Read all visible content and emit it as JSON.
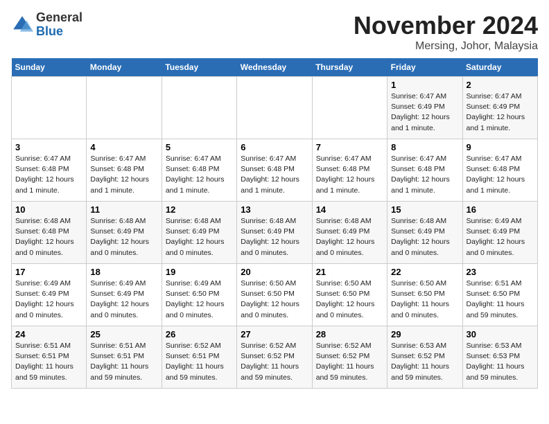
{
  "header": {
    "logo_general": "General",
    "logo_blue": "Blue",
    "month_title": "November 2024",
    "subtitle": "Mersing, Johor, Malaysia"
  },
  "weekdays": [
    "Sunday",
    "Monday",
    "Tuesday",
    "Wednesday",
    "Thursday",
    "Friday",
    "Saturday"
  ],
  "weeks": [
    [
      {
        "day": "",
        "info": ""
      },
      {
        "day": "",
        "info": ""
      },
      {
        "day": "",
        "info": ""
      },
      {
        "day": "",
        "info": ""
      },
      {
        "day": "",
        "info": ""
      },
      {
        "day": "1",
        "info": "Sunrise: 6:47 AM\nSunset: 6:49 PM\nDaylight: 12 hours and 1 minute."
      },
      {
        "day": "2",
        "info": "Sunrise: 6:47 AM\nSunset: 6:49 PM\nDaylight: 12 hours and 1 minute."
      }
    ],
    [
      {
        "day": "3",
        "info": "Sunrise: 6:47 AM\nSunset: 6:48 PM\nDaylight: 12 hours and 1 minute."
      },
      {
        "day": "4",
        "info": "Sunrise: 6:47 AM\nSunset: 6:48 PM\nDaylight: 12 hours and 1 minute."
      },
      {
        "day": "5",
        "info": "Sunrise: 6:47 AM\nSunset: 6:48 PM\nDaylight: 12 hours and 1 minute."
      },
      {
        "day": "6",
        "info": "Sunrise: 6:47 AM\nSunset: 6:48 PM\nDaylight: 12 hours and 1 minute."
      },
      {
        "day": "7",
        "info": "Sunrise: 6:47 AM\nSunset: 6:48 PM\nDaylight: 12 hours and 1 minute."
      },
      {
        "day": "8",
        "info": "Sunrise: 6:47 AM\nSunset: 6:48 PM\nDaylight: 12 hours and 1 minute."
      },
      {
        "day": "9",
        "info": "Sunrise: 6:47 AM\nSunset: 6:48 PM\nDaylight: 12 hours and 1 minute."
      }
    ],
    [
      {
        "day": "10",
        "info": "Sunrise: 6:48 AM\nSunset: 6:48 PM\nDaylight: 12 hours and 0 minutes."
      },
      {
        "day": "11",
        "info": "Sunrise: 6:48 AM\nSunset: 6:49 PM\nDaylight: 12 hours and 0 minutes."
      },
      {
        "day": "12",
        "info": "Sunrise: 6:48 AM\nSunset: 6:49 PM\nDaylight: 12 hours and 0 minutes."
      },
      {
        "day": "13",
        "info": "Sunrise: 6:48 AM\nSunset: 6:49 PM\nDaylight: 12 hours and 0 minutes."
      },
      {
        "day": "14",
        "info": "Sunrise: 6:48 AM\nSunset: 6:49 PM\nDaylight: 12 hours and 0 minutes."
      },
      {
        "day": "15",
        "info": "Sunrise: 6:48 AM\nSunset: 6:49 PM\nDaylight: 12 hours and 0 minutes."
      },
      {
        "day": "16",
        "info": "Sunrise: 6:49 AM\nSunset: 6:49 PM\nDaylight: 12 hours and 0 minutes."
      }
    ],
    [
      {
        "day": "17",
        "info": "Sunrise: 6:49 AM\nSunset: 6:49 PM\nDaylight: 12 hours and 0 minutes."
      },
      {
        "day": "18",
        "info": "Sunrise: 6:49 AM\nSunset: 6:49 PM\nDaylight: 12 hours and 0 minutes."
      },
      {
        "day": "19",
        "info": "Sunrise: 6:49 AM\nSunset: 6:50 PM\nDaylight: 12 hours and 0 minutes."
      },
      {
        "day": "20",
        "info": "Sunrise: 6:50 AM\nSunset: 6:50 PM\nDaylight: 12 hours and 0 minutes."
      },
      {
        "day": "21",
        "info": "Sunrise: 6:50 AM\nSunset: 6:50 PM\nDaylight: 12 hours and 0 minutes."
      },
      {
        "day": "22",
        "info": "Sunrise: 6:50 AM\nSunset: 6:50 PM\nDaylight: 11 hours and 0 minutes."
      },
      {
        "day": "23",
        "info": "Sunrise: 6:51 AM\nSunset: 6:50 PM\nDaylight: 11 hours and 59 minutes."
      }
    ],
    [
      {
        "day": "24",
        "info": "Sunrise: 6:51 AM\nSunset: 6:51 PM\nDaylight: 11 hours and 59 minutes."
      },
      {
        "day": "25",
        "info": "Sunrise: 6:51 AM\nSunset: 6:51 PM\nDaylight: 11 hours and 59 minutes."
      },
      {
        "day": "26",
        "info": "Sunrise: 6:52 AM\nSunset: 6:51 PM\nDaylight: 11 hours and 59 minutes."
      },
      {
        "day": "27",
        "info": "Sunrise: 6:52 AM\nSunset: 6:52 PM\nDaylight: 11 hours and 59 minutes."
      },
      {
        "day": "28",
        "info": "Sunrise: 6:52 AM\nSunset: 6:52 PM\nDaylight: 11 hours and 59 minutes."
      },
      {
        "day": "29",
        "info": "Sunrise: 6:53 AM\nSunset: 6:52 PM\nDaylight: 11 hours and 59 minutes."
      },
      {
        "day": "30",
        "info": "Sunrise: 6:53 AM\nSunset: 6:53 PM\nDaylight: 11 hours and 59 minutes."
      }
    ]
  ]
}
